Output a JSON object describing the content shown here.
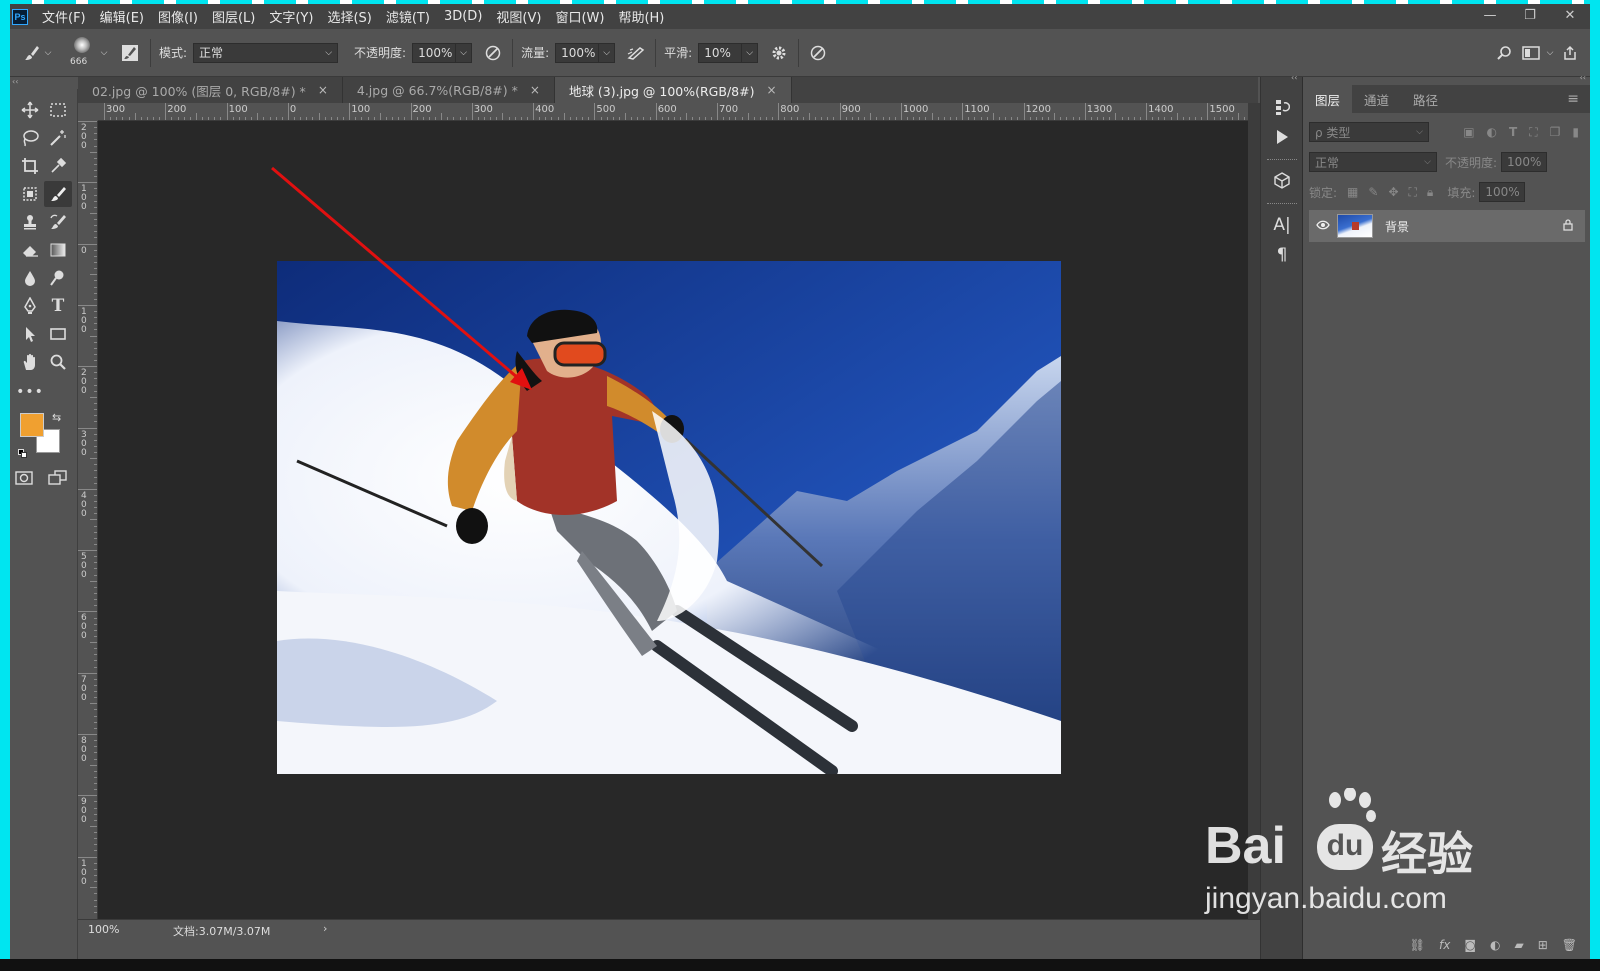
{
  "app": {
    "logo": "Ps"
  },
  "menu": [
    "文件(F)",
    "编辑(E)",
    "图像(I)",
    "图层(L)",
    "文字(Y)",
    "选择(S)",
    "滤镜(T)",
    "3D(D)",
    "视图(V)",
    "窗口(W)",
    "帮助(H)"
  ],
  "window_controls": {
    "minimize": "—",
    "restore": "❐",
    "close": "✕"
  },
  "options": {
    "brush_size": "666",
    "mode_label": "模式:",
    "mode_value": "正常",
    "opacity_label": "不透明度:",
    "opacity_value": "100%",
    "flow_label": "流量:",
    "flow_value": "100%",
    "smoothing_label": "平滑:",
    "smoothing_value": "10%"
  },
  "tabs": [
    {
      "label": "02.jpg @ 100% (图层 0, RGB/8#) *",
      "close": "×"
    },
    {
      "label": "4.jpg @ 66.7%(RGB/8#) *",
      "close": "×"
    },
    {
      "label": "地球 (3).jpg @ 100%(RGB/8#)",
      "close": "×"
    }
  ],
  "ruler": {
    "h_labels": [
      "300",
      "200",
      "100",
      "0",
      "100",
      "200",
      "300",
      "400",
      "500",
      "600",
      "700",
      "800",
      "900",
      "1000",
      "1100",
      "1200",
      "1300",
      "1400",
      "1500"
    ],
    "v_labels": [
      "2\n0\n0",
      "1\n0\n0",
      "0",
      "1\n0\n0",
      "2\n0\n0",
      "3\n0\n0",
      "4\n0\n0",
      "5\n0\n0",
      "6\n0\n0",
      "7\n0\n0",
      "8\n0\n0",
      "9\n0\n0",
      "1\n0\n0"
    ]
  },
  "status": {
    "zoom": "100%",
    "doc": "文档:3.07M/3.07M",
    "arrow": "›"
  },
  "layers_panel": {
    "tabs": [
      "图层",
      "通道",
      "路径"
    ],
    "filter_placeholder": "ρ 类型",
    "blend_mode": "正常",
    "opacity_label": "不透明度:",
    "opacity_value": "100%",
    "lock_label": "锁定:",
    "fill_label": "填充:",
    "fill_value": "100%",
    "layer_name": "背景"
  },
  "watermark": {
    "brand": "Bai",
    "du": "du",
    "jingyan": "经验",
    "url": "jingyan.baidu.com"
  },
  "colors": {
    "foreground": "#f0a030",
    "background": "#ffffff",
    "arrow": "#e11010"
  }
}
